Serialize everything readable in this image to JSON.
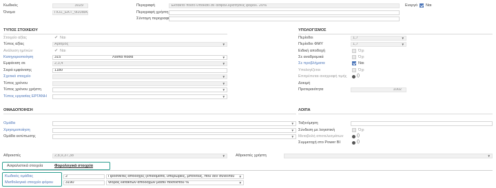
{
  "header": {
    "code_label": "Κωδικός",
    "code_value": "3029",
    "name_label": "Όνομα",
    "name_value": "ΠΟΣ_ΕΚΤ_Φ20ΜΑ",
    "desc_label": "Περιγραφή",
    "desc_value": "Έκτακτο ποσό υποκάθ.σε ασφαλ.κρατήσεις φορολ. 20%",
    "user_desc_label": "Περιγραφή χρήστη",
    "short_desc_label": "Σύντομη περιγραφή",
    "active_label": "Ενεργό",
    "active_value": "Ναι"
  },
  "type_section": {
    "title": "ΤΥΠΟΣ ΣΤΟΙΧΕΙΟΥ",
    "rows": [
      {
        "label": "Στοιχείο αξίας",
        "value": "Ναι"
      },
      {
        "label": "Τύπος αξίας",
        "value": "Αριθμός"
      },
      {
        "label": "Ανάλυση ημ/νιών",
        "value": "Ναι"
      },
      {
        "label": "Κατηγοριοποίηση",
        "value": "315",
        "extra": "Λοιπά ποσά"
      },
      {
        "label": "Εμφάνιση σε",
        "value": "2,3,4"
      },
      {
        "label": "Σειρά εμφάνισης",
        "value": "1180"
      },
      {
        "label": "Σχετικό στοιχείο",
        "value": ""
      },
      {
        "label": "Τύπος χρόνου",
        "value": ""
      },
      {
        "label": "Τύπος χρόνου χρήστη",
        "value": ""
      },
      {
        "label": "Τύπος εργασίας ΕΡΓΑΝΗ",
        "value": ""
      }
    ]
  },
  "calc_section": {
    "title": "ΥΠΟΛΟΓΙΣΜΟΣ",
    "rows": [
      {
        "label": "Περίοδοι",
        "value": "1,7"
      },
      {
        "label": "Περίοδοι ΦΜΥ",
        "value": "1,7"
      },
      {
        "label": "Ειδική αποδοχή",
        "value": "Όχι"
      },
      {
        "label": "Σε αναδρομικά",
        "value": "Όχι"
      },
      {
        "label": "Σε προβλήματα",
        "value": "Ναι"
      },
      {
        "label": "Υπολογίζεται",
        "value": "Όχι"
      },
      {
        "label": "Επιτρέπεται αναγραφή τιμής",
        "value": ""
      },
      {
        "label": "Δοκιμή",
        "value": ""
      },
      {
        "label": "Προτεραιότητα",
        "value": "1002"
      }
    ]
  },
  "grouping_section": {
    "title": "ΟΜΑΔΟΠΟΙΗΣΗ",
    "rows": [
      {
        "label": "Ομάδα",
        "value": ""
      },
      {
        "label": "Χρησιμοποίηση",
        "value": ""
      },
      {
        "label": "Ομάδα εκτύπωσης",
        "value": ""
      }
    ]
  },
  "other_section": {
    "title": "ΛΟΙΠΑ",
    "rows": [
      {
        "label": "Ταξινόμηση",
        "value": ""
      },
      {
        "label": "Σύνδεση με λογιστική",
        "value": "Όχι"
      },
      {
        "label": "Μεταβολή αποτελεσμάτων",
        "value": ""
      },
      {
        "label": "Συμμετοχή στο Power BI",
        "value": ""
      }
    ]
  },
  "sums": {
    "label": "Αθροιστές",
    "value": "2,8,9,37,38",
    "user_label": "Αθροιστές χρήστη",
    "user_value": ""
  },
  "tabs": [
    {
      "label": "Ασφαλιστικά στοιχεία"
    },
    {
      "label": "Φορολογικά στοιχεία"
    }
  ],
  "tax_table": {
    "rows": [
      {
        "label": "Κωδικός ομάδας",
        "code": "2",
        "desc": "Πρόσθετες αποδοχές (επιδόματα, υπερωρίες, μπόνους, που δεν συνεντεύ"
      },
      {
        "label": "Μισθολογικό στοιχείο φόρου",
        "code": "3190",
        "desc": "Φόρος εκτάκτων αποδοχών βάσει ποσοστού %"
      }
    ]
  },
  "colors": {
    "accent": "#4a74b8",
    "highlight": "#2a9d8f"
  }
}
